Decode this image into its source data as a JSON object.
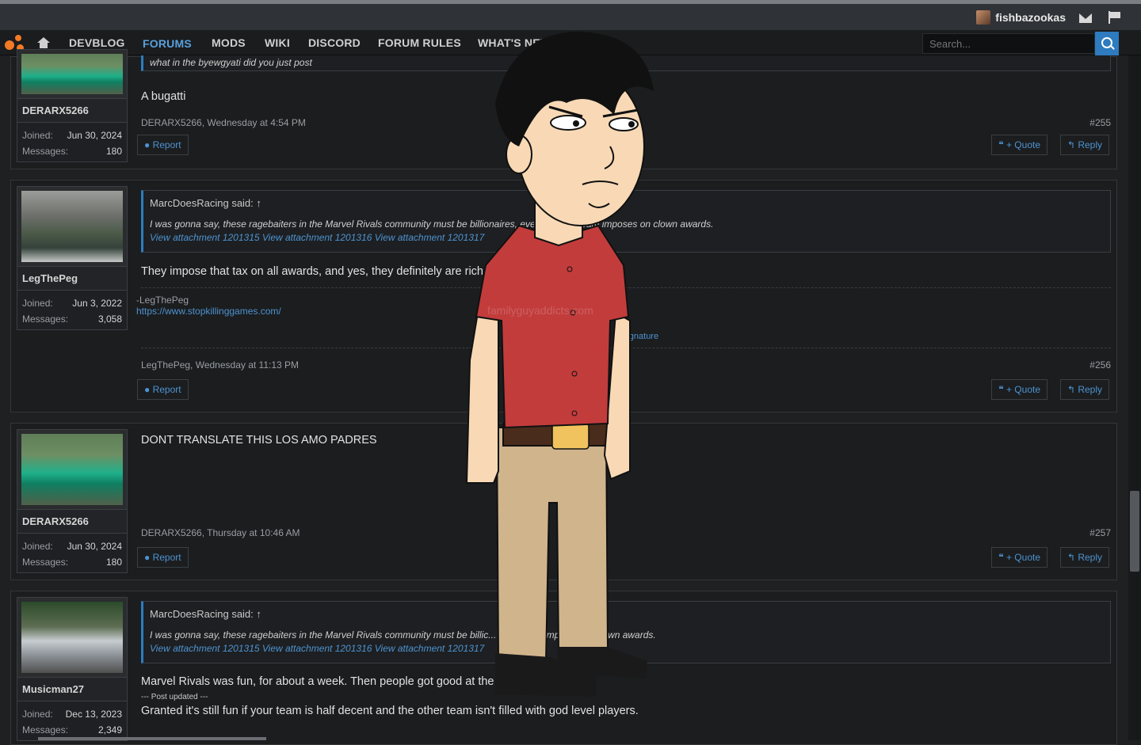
{
  "header": {
    "username": "fishbazookas",
    "nav": [
      "DEVBLOG",
      "FORUMS",
      "MODS",
      "WIKI",
      "DISCORD",
      "FORUM RULES",
      "WHAT'S NEW"
    ],
    "search_placeholder": "Search..."
  },
  "sticker_watermark": "familyguyaddicts.com",
  "posts": [
    {
      "quote_tail": "what in the byewgyati did you just post",
      "author": "DERARX5266",
      "joined_label": "Joined:",
      "joined": "Jun 30, 2024",
      "messages_label": "Messages:",
      "messages": "180",
      "body": "A bugatti",
      "meta": "DERARX5266, Wednesday at 4:54 PM",
      "num": "#255",
      "report": "Report",
      "quote_btn": "+ Quote",
      "reply_btn": "Reply"
    },
    {
      "author": "LegThePeg",
      "joined_label": "Joined:",
      "joined": "Jun 3, 2022",
      "messages_label": "Messages:",
      "messages": "3,058",
      "quote_attr": "MarcDoesRacing said: ↑",
      "quote_text": "I was gonna say, these ragebaiters in the Marvel Rivals community must be billionaires, every ... tax Steam imposes on clown awards.",
      "quote_links": "View attachment 1201315 View attachment 1201316 View attachment 1201317",
      "body": "They impose that tax on all awards, and yes, they definitely are rich.",
      "sig_name": "-LegThePeg",
      "sig_link": "https://www.stopkillinggames.com/",
      "sig_toggle": "Signature",
      "meta": "LegThePeg, Wednesday at 11:13 PM",
      "num": "#256",
      "report": "Report",
      "quote_btn": "+ Quote",
      "reply_btn": "Reply"
    },
    {
      "author": "DERARX5266",
      "joined_label": "Joined:",
      "joined": "Jun 30, 2024",
      "messages_label": "Messages:",
      "messages": "180",
      "body": "DONT TRANSLATE THIS LOS AMO PADRES",
      "meta": "DERARX5266, Thursday at 10:46 AM",
      "num": "#257",
      "report": "Report",
      "quote_btn": "+ Quote",
      "reply_btn": "Reply"
    },
    {
      "author": "Musicman27",
      "joined_label": "Joined:",
      "joined": "Dec 13, 2023",
      "messages_label": "Messages:",
      "messages": "2,349",
      "quote_attr": "MarcDoesRacing said: ↑",
      "quote_text": "I was gonna say, these ragebaiters in the Marvel Rivals community must be billic... tax Steam imposes on clown awards.",
      "quote_links": "View attachment 1201315 View attachment 1201316 View attachment 1201317",
      "body": "Marvel Rivals was fun, for about a week. Then people got good at the g... started up.",
      "post_updated": "--- Post updated ---",
      "body2": "Granted it's still fun if your team is half decent and the other team isn't filled with god level players."
    }
  ]
}
